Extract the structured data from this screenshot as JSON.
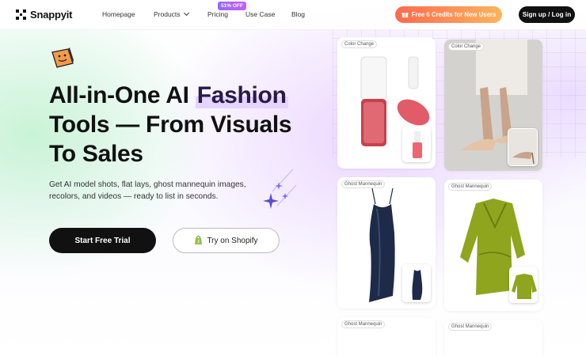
{
  "brand": {
    "name": "Snappyit"
  },
  "nav": {
    "homepage": "Homepage",
    "products": "Products",
    "pricing": "Pricing",
    "pricing_badge": "51% OFF",
    "use_case": "Use Case",
    "blog": "Blog"
  },
  "header_actions": {
    "credits_label": "Free 6 Credits for New Users",
    "signup_label": "Sign up / Log in"
  },
  "hero": {
    "title_before": "All-in-One AI ",
    "title_highlight": "Fashion",
    "title_after": " Tools — From Visuals To Sales",
    "subtitle": "Get AI model shots, flat lays, ghost mannequin images, recolors, and videos — ready to list in seconds.",
    "primary_button": "Start Free Trial",
    "secondary_button": "Try on Shopify"
  },
  "gallery": {
    "cards": [
      {
        "tag": "Color Change"
      },
      {
        "tag": "Color Change"
      },
      {
        "tag": "Ghost Mannequin"
      },
      {
        "tag": "Ghost Mannequin"
      },
      {
        "tag": "Ghost Mannequin"
      },
      {
        "tag": "Ghost Mannequin"
      }
    ]
  },
  "colors": {
    "accent_purple": "#8f6bff",
    "credits_gradient_start": "#ff6a4d",
    "credits_gradient_end": "#ffb35c",
    "primary_dark": "#111111"
  },
  "icons": [
    "gift-icon",
    "shopify-bag-icon",
    "chevron-down-icon",
    "sparkle-icon",
    "mascot-icon"
  ]
}
